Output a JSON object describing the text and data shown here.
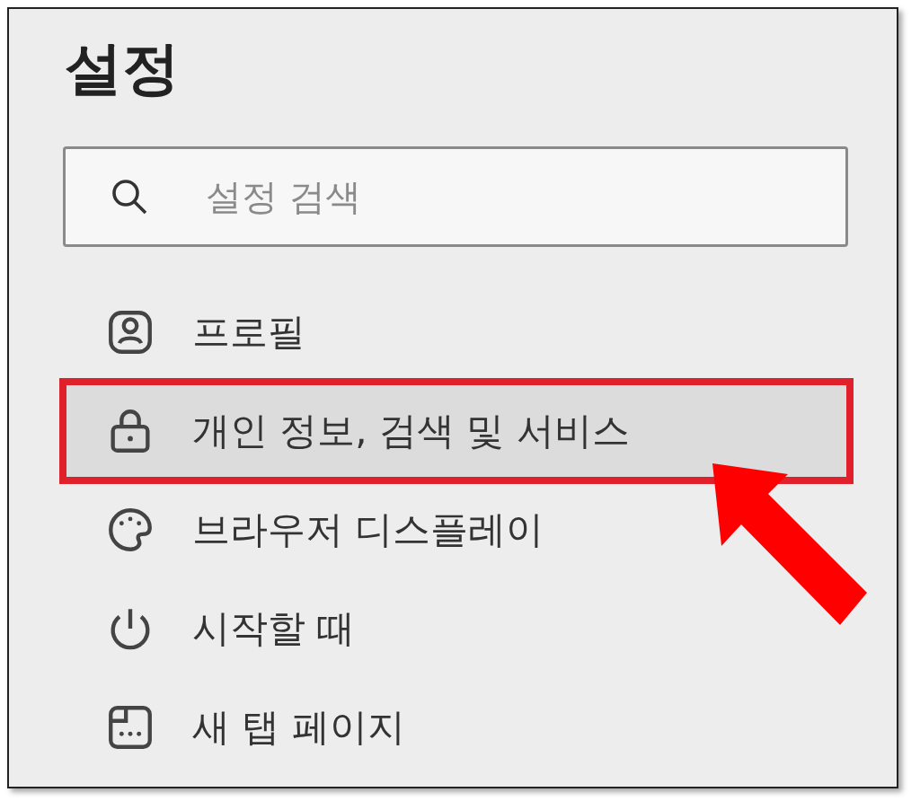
{
  "title": "설정",
  "search": {
    "placeholder": "설정 검색"
  },
  "menu": [
    {
      "label": "프로필",
      "kind": "profile",
      "selected": false,
      "annotated": false
    },
    {
      "label": "개인 정보, 검색 및 서비스",
      "kind": "lock",
      "selected": true,
      "annotated": true
    },
    {
      "label": "브라우저 디스플레이",
      "kind": "palette",
      "selected": false,
      "annotated": false
    },
    {
      "label": "시작할 때",
      "kind": "power",
      "selected": false,
      "annotated": false
    },
    {
      "label": "새 탭 페이지",
      "kind": "newtab",
      "selected": false,
      "annotated": false
    }
  ]
}
